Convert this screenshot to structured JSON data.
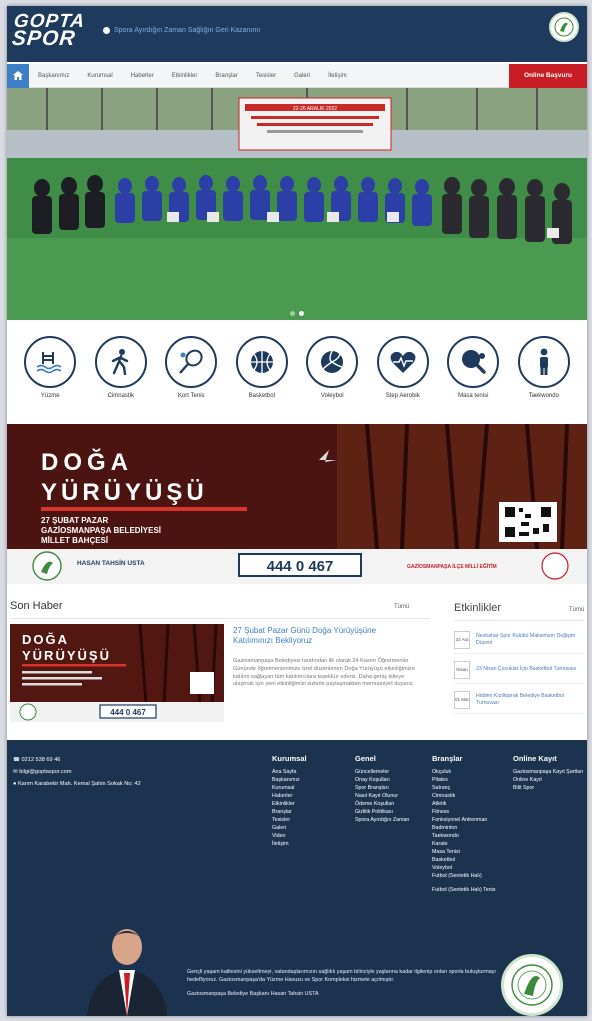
{
  "header": {
    "logo_line1": "GOPTA",
    "logo_line2": "SPOR",
    "announcement": "Spora Ayırdığın Zaman Sağlığın Geri Kazanımı"
  },
  "nav": {
    "items": [
      "Başkanımız",
      "Kurumsal",
      "Haberler",
      "Etkinlikler",
      "Branşlar",
      "Tesisler",
      "Galeri",
      "İletişim"
    ],
    "online_label": "Online Başvuru"
  },
  "hero": {
    "banner_text": "22-26 ARALIK 2022",
    "slide_count": 2,
    "active_slide": 1
  },
  "sports": [
    {
      "label": "Yüzme",
      "icon": "swimming-icon"
    },
    {
      "label": "Cimnastik",
      "icon": "walking-person-icon"
    },
    {
      "label": "Kort Tenis",
      "icon": "tennis-racket-icon"
    },
    {
      "label": "Basketbol",
      "icon": "basketball-icon"
    },
    {
      "label": "Voleybol",
      "icon": "volleyball-icon"
    },
    {
      "label": "Step Aerobik",
      "icon": "heartbeat-icon"
    },
    {
      "label": "Masa tenisi",
      "icon": "table-tennis-icon"
    },
    {
      "label": "Taekwondo",
      "icon": "person-icon"
    }
  ],
  "banner": {
    "title1": "DOĞA",
    "title2": "YÜRÜYÜŞÜ",
    "date_line": "27 ŞUBAT PAZAR",
    "place_line1": "GAZİOSMANPAŞA BELEDİYESİ",
    "place_line2": "MİLLET BAHÇESİ",
    "sponsor": "HASAN TAHSİN USTA",
    "phone": "444 0 467",
    "right_org": "GAZİOSMANPAŞA İLÇE MİLLİ EĞİTİM"
  },
  "news": {
    "section_title": "Son Haber",
    "all_label": "Tümü",
    "headline": "27 Şubat Pazar Günü Doğa Yürüyüşüne Katılımınızı Bekliyoruz",
    "excerpt": "Gaziosmanpaşa Belediyesi tarafından ilk olarak 24 Kasım Öğretmenler Gününde öğretmenlerimize özel düzenlenen Doğa Yürüyüşü etkinliğimize katılım sağlayan tüm katılımcılara teşekkür ederiz. Daha geniş kitleye ulaşmak için yeni etkinliğimizi sizlerle paylaşmaktan memnuniyet duyarız."
  },
  "events": {
    "section_title": "Etkinlikler",
    "all_label": "Tümü",
    "items": [
      {
        "date": "22 Ara",
        "text": "Nevbahar Spor Kulübü Maksimum Değişim Düzeni"
      },
      {
        "date": "Nisan",
        "text": "23 Nisan Çocuklar İçin Basketbol Turnuvası"
      },
      {
        "date": "01 Mar",
        "text": "Hidden Kızıltoprak Belediye Basketbol Turnuvası"
      }
    ]
  },
  "footer": {
    "phone": "0212 538 69 46",
    "email": "bilgi@goptaspor.com",
    "address": "Karım Karabekir Mah. Kemal Şahin Sokak No: 42",
    "columns": [
      {
        "title": "Kurumsal",
        "items": [
          "Ana Sayfa",
          "Başkanımız",
          "Kurumsal",
          "Haberler",
          "Etkinlikler",
          "Branşlar",
          "Tesisler",
          "Galeri",
          "Video",
          "İletişim"
        ]
      },
      {
        "title": "Genel",
        "items": [
          "Güncellemeler",
          "Onay Koşulları",
          "Spor Branşları",
          "Nasıl Kayıt Olunur",
          "Ödeme Koşulları",
          "Gizlilik Politikası",
          "Spora Ayırdığın Zaman"
        ]
      },
      {
        "title": "Branşlar",
        "items": [
          "Okçuluk",
          "Pilates",
          "Satranç",
          "Cimnastik",
          "Atletik",
          "Fitness",
          "Fonksiyonel Antrenman",
          "Badminton",
          "Taekwondo",
          "Karate",
          "Masa Tenisi",
          "Basketbol",
          "Voleybol",
          "Futbol (Sentetik Halı)"
        ]
      },
      {
        "title": "Online Kayıt",
        "items": [
          "Gaziosmanpaşa Kayıt Şartları",
          "Online Kayıt",
          "Bilit Spor"
        ]
      }
    ],
    "bottom_note": "Futbol (Sentetik Halı)  Tenis",
    "quote": "Gençli yaşam kalitesini yükseltmeyi, vatandaşlarımızın sağlıklı yaşam bilinciyle yaşlarına kadar ilgilenip onları sporla buluşturmayı hedefliyoruz. Gaziosmanpaşa'da Yüzme Havuzu ve Spor Kompleksi hizmete açılmıştır.",
    "signature": "Gaziosmanpaşa Belediye Başkanı Hasan Tahsin USTA"
  },
  "colors": {
    "navy": "#1e3a5c",
    "red": "#c81d25",
    "accent_blue": "#3d7fc4"
  }
}
